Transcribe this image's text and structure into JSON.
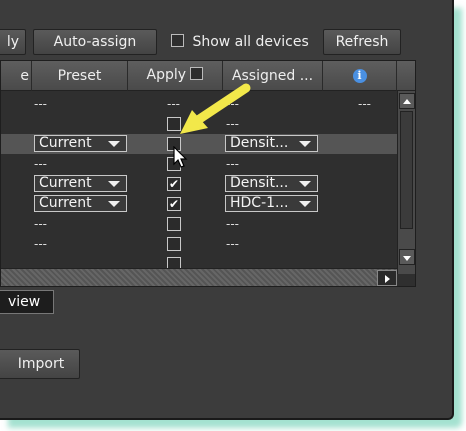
{
  "toolbar": {
    "partial_button": "ly",
    "auto_assign": "Auto-assign",
    "show_all_devices": "Show all devices",
    "refresh": "Refresh"
  },
  "table": {
    "headers": {
      "first_partial": "e",
      "preset": "Preset",
      "apply": "Apply",
      "assigned": "Assigned ...",
      "info_icon": "info-icon"
    },
    "dash": "---",
    "rows": [
      {
        "preset_dash": "---",
        "apply": "---",
        "assigned": "---",
        "info": "---"
      },
      {
        "preset_dash": "",
        "apply": "unchecked",
        "assigned": "---",
        "info": ""
      },
      {
        "preset": "Current",
        "apply": "unchecked",
        "assigned": "Densit...",
        "info": ""
      },
      {
        "preset_dash": "---",
        "apply": "unchecked",
        "assigned": "---",
        "info": ""
      },
      {
        "preset": "Current",
        "apply": "checked",
        "assigned": "Densit...",
        "info": ""
      },
      {
        "preset": "Current",
        "apply": "checked",
        "assigned": "HDC-1...",
        "info": ""
      },
      {
        "preset_dash": "---",
        "apply": "unchecked",
        "assigned": "---",
        "info": ""
      },
      {
        "preset_dash": "---",
        "apply": "unchecked",
        "assigned": "---",
        "info": ""
      }
    ]
  },
  "tab_label": "view",
  "import_button": "Import",
  "colors": {
    "panel_bg": "#3c3c3c",
    "callout_arrow": "#f2e84a",
    "info_icon": "#4a90e2",
    "glow": "#5ac8aa"
  },
  "icons": [
    "info-icon",
    "mouse-cursor-icon",
    "callout-arrow-icon",
    "dropdown-arrow-icon",
    "scroll-up-icon",
    "scroll-down-icon",
    "scroll-right-icon"
  ]
}
